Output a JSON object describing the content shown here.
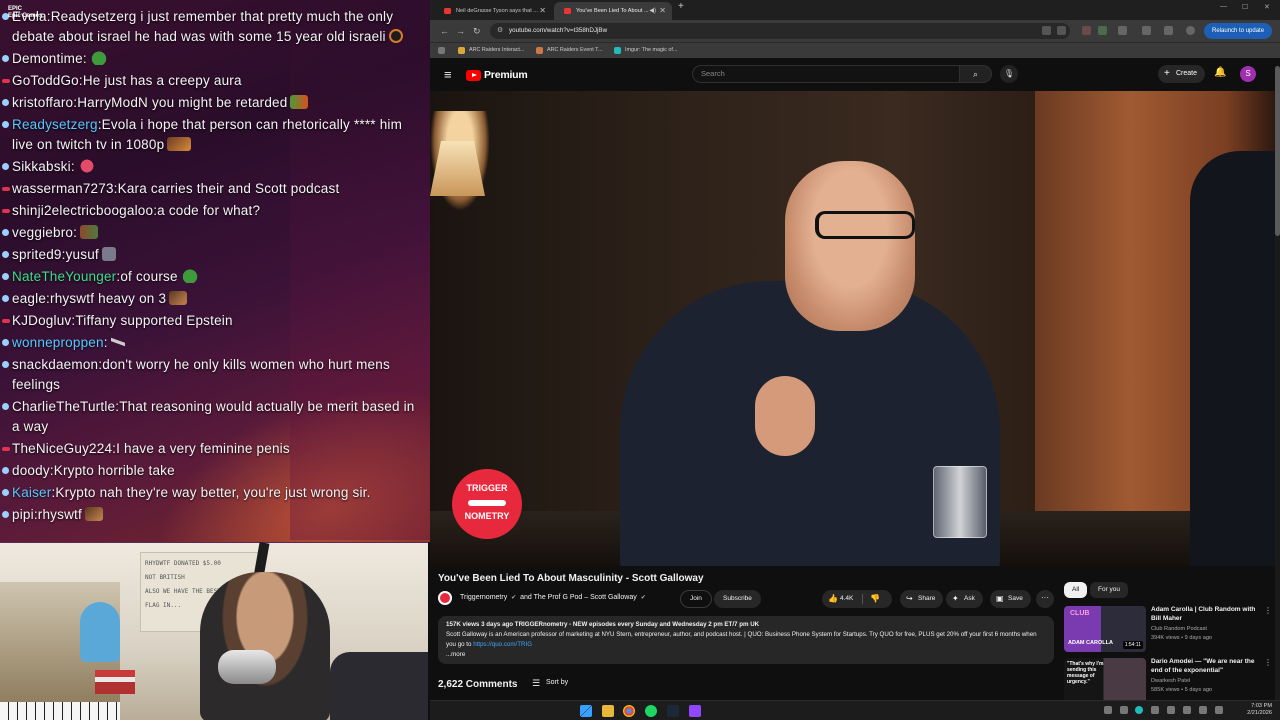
{
  "stream": {
    "logo_text": "EPIC\nEpic Games",
    "chat": [
      {
        "user": "Evola",
        "text": "Readysetzerg i just remember that pretty much the only debate about israel he had was with some 15 year old israeli",
        "badge": "blue",
        "user_color": "white",
        "emote": "ring"
      },
      {
        "user": "Demontime",
        "text": "",
        "badge": "blue",
        "user_color": "white",
        "emote": "frog"
      },
      {
        "user": "GoToddGo",
        "text": "He just has a creepy aura",
        "badge": "red",
        "user_color": "white",
        "emote": ""
      },
      {
        "user": "kristoffaro",
        "text": "HarryModN you might be retarded",
        "badge": "blue",
        "user_color": "white",
        "emote": "fire"
      },
      {
        "user": "Readysetzerg",
        "text": "Evola i hope that person can rhetorically **** him live on twitch tv in 1080p",
        "badge": "blue",
        "user_color": "blue",
        "emote": "pic"
      },
      {
        "user": "Sikkabski",
        "text": "",
        "badge": "blue",
        "user_color": "white",
        "emote": "lips"
      },
      {
        "user": "wasserman7273",
        "text": "Kara carries their and Scott podcast",
        "badge": "red",
        "user_color": "white",
        "emote": ""
      },
      {
        "user": "shinji2electricboogaloo",
        "text": "a code for what?",
        "badge": "red",
        "user_color": "white",
        "emote": ""
      },
      {
        "user": "veggiebro",
        "text": "",
        "badge": "blue",
        "user_color": "white",
        "emote": "mask"
      },
      {
        "user": "sprited9",
        "text": "yusuf",
        "badge": "blue",
        "user_color": "white",
        "emote": "gray"
      },
      {
        "user": "NateTheYounger",
        "text": "of course",
        "badge": "blue",
        "user_color": "green",
        "emote": "frog"
      },
      {
        "user": "eagle",
        "text": "rhyswtf heavy on 3",
        "badge": "blue",
        "user_color": "white",
        "emote": "cat"
      },
      {
        "user": "KJDogluv",
        "text": "Tiffany supported Epstein",
        "badge": "red",
        "user_color": "white",
        "emote": ""
      },
      {
        "user": "wonneproppen",
        "text": "",
        "badge": "blue",
        "user_color": "blue",
        "emote": "gun"
      },
      {
        "user": "snackdaemon",
        "text": "don't worry he only kills women who hurt mens feelings",
        "badge": "blue",
        "user_color": "white",
        "emote": ""
      },
      {
        "user": "CharlieTheTurtle",
        "text": "That reasoning would actually be merit based in a way",
        "badge": "blue",
        "user_color": "white",
        "emote": ""
      },
      {
        "user": "TheNiceGuy224",
        "text": "I have a very feminine penis",
        "badge": "red",
        "user_color": "white",
        "emote": ""
      },
      {
        "user": "doody",
        "text": "Krypto horrible take",
        "badge": "blue",
        "user_color": "white",
        "emote": ""
      },
      {
        "user": "Kaiser",
        "text": "Krypto nah they're way better, you're just wrong sir.",
        "badge": "blue",
        "user_color": "blue",
        "emote": ""
      },
      {
        "user": "pipi",
        "text": "rhyswtf",
        "badge": "blue",
        "user_color": "white",
        "emote": "cat"
      }
    ],
    "webcam_poster_text": "RHYDWTF DONATED $5.00\nNOT BRITISH\nALSO WE HAVE THE BEST\nFLAG IN..."
  },
  "browser": {
    "tabs": [
      {
        "title": "Neil deGrasse Tyson says that ...",
        "active": false
      },
      {
        "title": "You've Been Lied To About ...",
        "active": true
      }
    ],
    "url": "youtube.com/watch?v=t358hDJjBw",
    "relaunch_label": "Relaunch to update",
    "bookmarks": [
      "ARC Raiders Interact...",
      "ARC Raiders Event T...",
      "Imgur: The magic of..."
    ]
  },
  "youtube": {
    "brand": "Premium",
    "search_placeholder": "Search",
    "create_label": "Create",
    "avatar_letter": "S",
    "video_logo_top": "TRIGGER",
    "video_logo_bottom": "NOMETRY",
    "title": "You've Been Lied To About Masculinity - Scott Galloway",
    "channel_primary": "Triggernometry",
    "channel_and": "and",
    "channel_secondary": "The Prof G Pod – Scott Galloway",
    "join_label": "Join",
    "subscribe_label": "Subscribe",
    "likes": "4.4K",
    "share_label": "Share",
    "ask_label": "Ask",
    "save_label": "Save",
    "description": {
      "meta": "157K views  3 days ago  TRIGGERnometry - NEW episodes every Sunday and Wednesday 2 pm ET/7 pm UK",
      "body": "Scott Galloway is an American professor of marketing at NYU Stern, entrepreneur, author, and podcast host. | QUO: Business Phone System for Startups. Try QUO for free, PLUS get 20% off your first 6 months when you go to",
      "link": "https://quo.com/TRIG",
      "more": "...more"
    },
    "comments_count": "2,622 Comments",
    "sort_label": "Sort by",
    "chips": [
      "All",
      "For you"
    ],
    "recommendations": [
      {
        "title": "Adam Carolla | Club Random with Bill Maher",
        "channel": "Club Random Podcast",
        "meta": "394K views • 9 days ago",
        "duration": "1:54:11",
        "thumb_text_top": "CLUB",
        "thumb_text_bottom": "ADAM CAROLLA"
      },
      {
        "title": "Dario Amodei — \"We are near the end of the exponential\"",
        "channel": "Dwarkesh Patel",
        "meta": "585K views • 5 days ago",
        "duration": "",
        "thumb_text_top": "\"That's why I'm sending this message of urgency.\"",
        "thumb_text_bottom": ""
      }
    ]
  },
  "taskbar": {
    "time": "7:03 PM",
    "date": "2/21/2026"
  }
}
